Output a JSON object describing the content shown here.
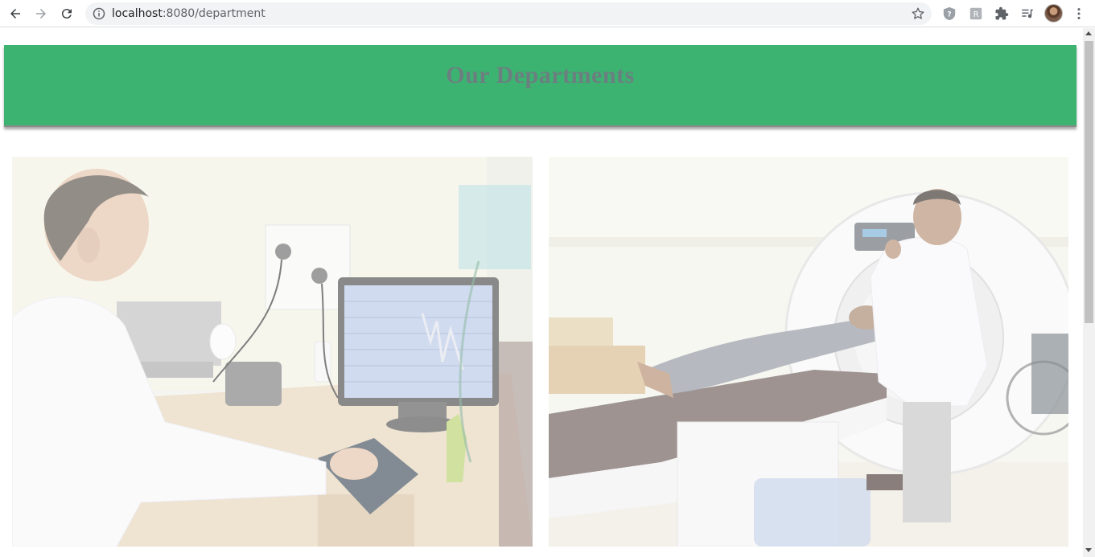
{
  "browser": {
    "url_host": "localhost",
    "url_path": ":8080/department",
    "icons": [
      "back-icon",
      "forward-icon",
      "reload-icon",
      "info-icon",
      "star-icon",
      "help-extension-icon",
      "r-extension-icon",
      "extensions-puzzle-icon",
      "media-queue-icon",
      "profile-avatar",
      "more-menu-icon"
    ]
  },
  "page": {
    "banner_title": "Our Departments",
    "banner_color": "#3cb371",
    "title_color": "#6c7f80",
    "photos": [
      {
        "name": "ecg-department-photo"
      },
      {
        "name": "ct-scan-department-photo"
      }
    ]
  }
}
